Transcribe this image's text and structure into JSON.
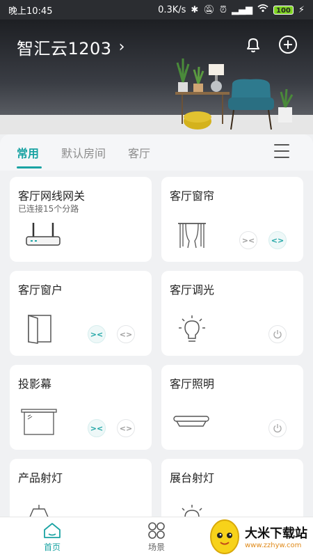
{
  "status": {
    "time": "晚上10:45",
    "speed": "0.3K/s",
    "battery": "100"
  },
  "header": {
    "home_name": "智汇云1203",
    "chevron": "›"
  },
  "tabs": [
    {
      "label": "常用",
      "active": true
    },
    {
      "label": "默认房间",
      "active": false
    },
    {
      "label": "客厅",
      "active": false
    }
  ],
  "devices": [
    {
      "name": "客厅网线网关",
      "subtitle": "已连接15个分路",
      "icon": "gateway-icon"
    },
    {
      "name": "客厅窗帘",
      "icon": "curtain-icon",
      "controls": [
        "close",
        "open"
      ]
    },
    {
      "name": "客厅窗户",
      "icon": "window-icon",
      "controls": [
        "close",
        "open"
      ]
    },
    {
      "name": "客厅调光",
      "icon": "bulb-icon",
      "controls": [
        "power"
      ]
    },
    {
      "name": "投影幕",
      "icon": "projector-screen-icon",
      "controls": [
        "close",
        "open"
      ]
    },
    {
      "name": "客厅照明",
      "icon": "ceiling-light-icon",
      "controls": [
        "power"
      ]
    },
    {
      "name": "产品射灯",
      "icon": "spotlight-icon"
    },
    {
      "name": "展台射灯",
      "icon": "bulb-icon"
    }
  ],
  "controls": {
    "close": "><",
    "open": "<>"
  },
  "nav": {
    "home": "首页",
    "scene": "场景"
  },
  "watermark": {
    "title": "大米下载站",
    "url": "www.zzhyw.com"
  },
  "colors": {
    "accent": "#1aa3a3",
    "card": "#ffffff",
    "background": "#f0f1f3"
  }
}
